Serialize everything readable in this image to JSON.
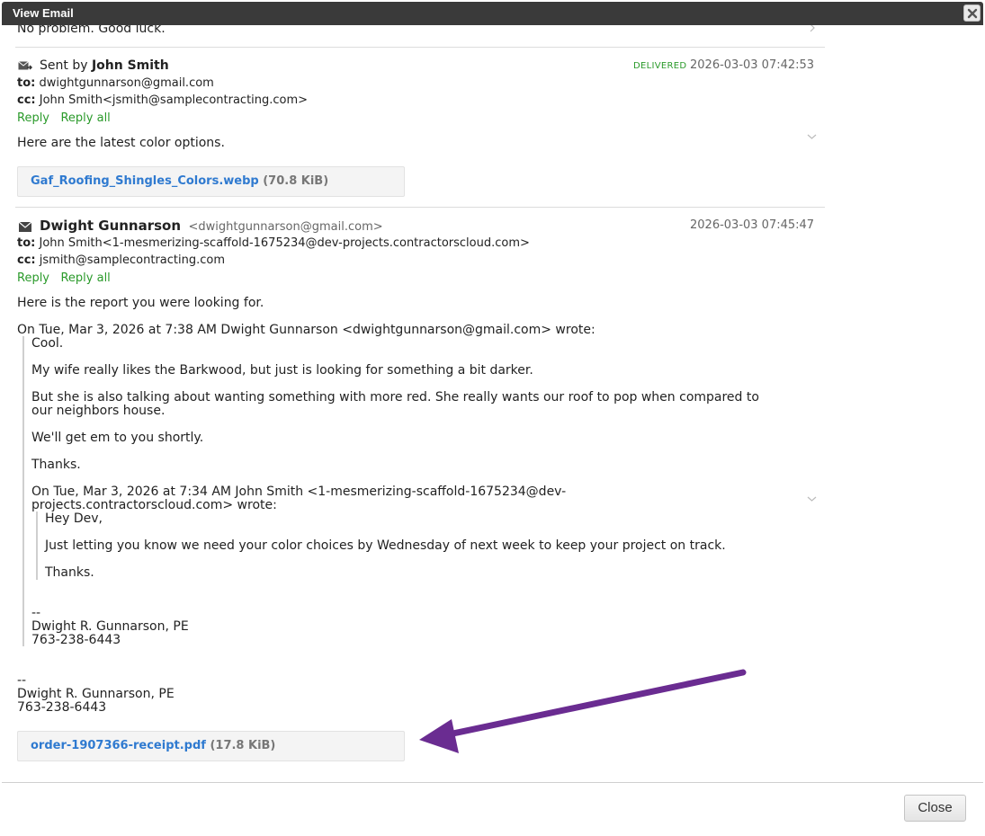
{
  "window": {
    "title": "View Email"
  },
  "prev_message_tail": "No problem. Good luck.",
  "message1": {
    "sent_by_prefix": "Sent by",
    "sender": "John Smith",
    "status": "DELIVERED",
    "timestamp": "2026-03-03 07:42:53",
    "to_label": "to:",
    "to": "dwightgunnarson@gmail.com",
    "cc_label": "cc:",
    "cc": "John Smith<jsmith@samplecontracting.com>",
    "reply": "Reply",
    "reply_all": "Reply all",
    "body": "Here are the latest color options.",
    "attachment": {
      "name": "Gaf_Roofing_Shingles_Colors.webp",
      "size": "(70.8 KiB)"
    }
  },
  "message2": {
    "sender": "Dwight Gunnarson",
    "sender_email": "<dwightgunnarson@gmail.com>",
    "timestamp": "2026-03-03 07:45:47",
    "to_label": "to:",
    "to": "John Smith<1-mesmerizing-scaffold-1675234@dev-projects.contractorscloud.com>",
    "cc_label": "cc:",
    "cc": "jsmith@samplecontracting.com",
    "reply": "Reply",
    "reply_all": "Reply all",
    "body": "Here is the report you were looking for.",
    "quote_header": "On Tue, Mar 3, 2026 at 7:38 AM Dwight Gunnarson <dwightgunnarson@gmail.com> wrote:",
    "quote_lines": [
      "Cool.",
      "My wife really likes the Barkwood, but just is looking for something a bit darker.",
      "But she is also talking about wanting something with more red. She really wants our roof to pop when compared to",
      "our neighbors house.",
      "We'll get em to you shortly.",
      "Thanks."
    ],
    "nested_header_1": "On Tue, Mar 3, 2026 at 7:34 AM John Smith <1-mesmerizing-scaffold-1675234@dev-",
    "nested_header_2": "projects.contractorscloud.com> wrote:",
    "nested_lines": [
      "Hey Dev,",
      "Just letting you know we need your color choices by Wednesday of next week to keep your project on track.",
      "Thanks."
    ],
    "quote_sig": [
      "--",
      "Dwight R. Gunnarson, PE",
      "763-238-6443"
    ],
    "signature": [
      "--",
      "Dwight R. Gunnarson, PE",
      "763-238-6443"
    ],
    "attachment": {
      "name": "order-1907366-receipt.pdf",
      "size": "(17.8 KiB)"
    }
  },
  "footer": {
    "close_label": "Close"
  },
  "colors": {
    "titlebar": "#3a3a3a",
    "status_green": "#2a9a2a",
    "link_blue": "#2f7ad0",
    "arrow_purple": "#6a2c91"
  },
  "icons": [
    "close-icon",
    "sent-mail-icon",
    "mail-icon",
    "chevron-right-icon",
    "chevron-down-icon"
  ]
}
